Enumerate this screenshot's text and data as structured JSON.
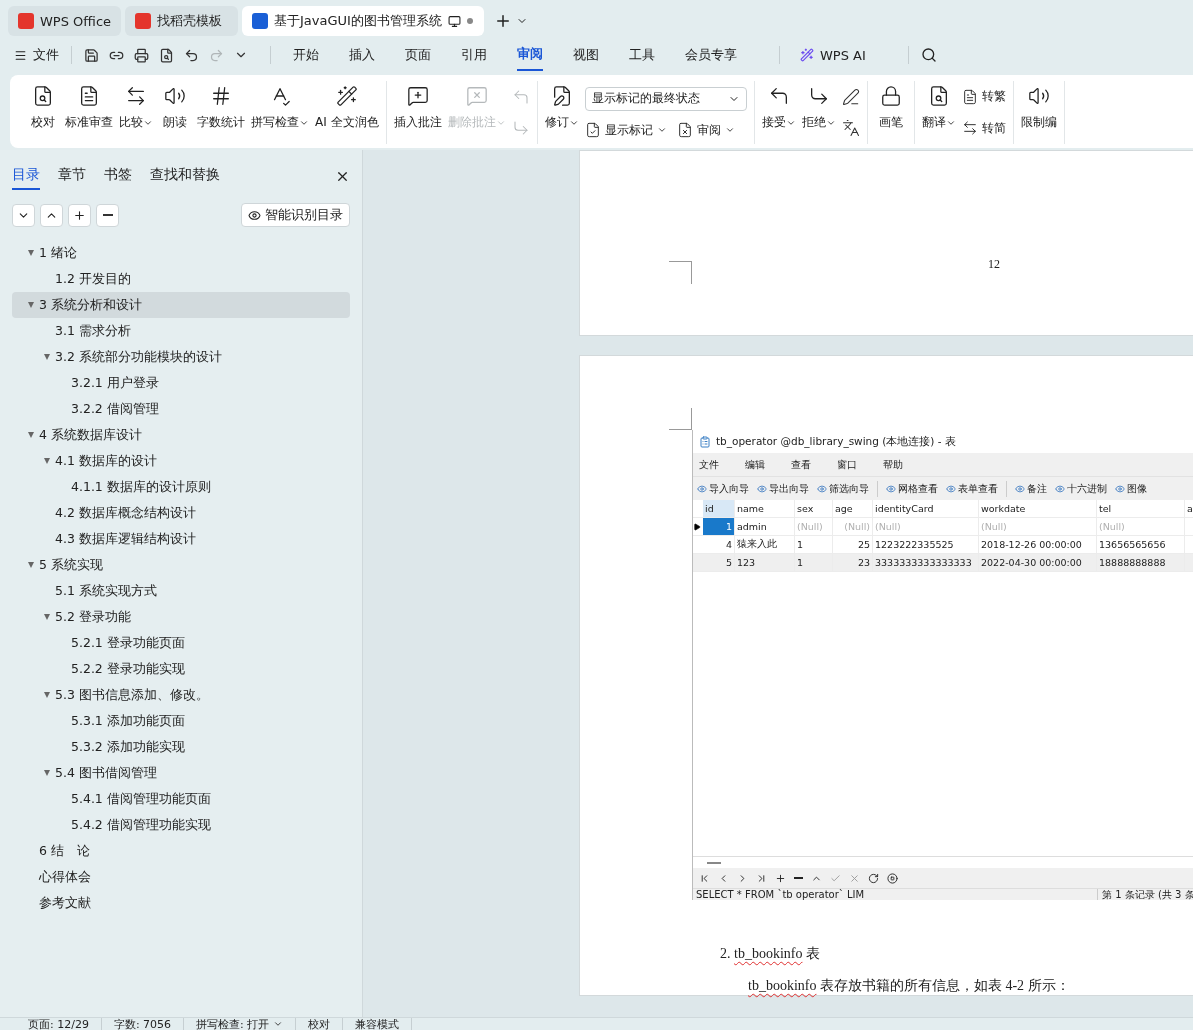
{
  "tabs": [
    {
      "label": "WPS Office",
      "selected": false
    },
    {
      "label": "找稻壳模板",
      "selected": false
    },
    {
      "label": "基于JavaGUI的图书管理系统",
      "selected": true
    }
  ],
  "menu": {
    "file": "文件",
    "items": [
      {
        "label": "开始",
        "selected": false
      },
      {
        "label": "插入",
        "selected": false
      },
      {
        "label": "页面",
        "selected": false
      },
      {
        "label": "引用",
        "selected": false
      },
      {
        "label": "审阅",
        "selected": true
      },
      {
        "label": "视图",
        "selected": false
      },
      {
        "label": "工具",
        "selected": false
      },
      {
        "label": "会员专享",
        "selected": false
      }
    ],
    "ai": "WPS AI"
  },
  "ribbon": [
    {
      "items": [
        {
          "kind": "big",
          "label": "校对",
          "dropdown": false,
          "disabled": false
        },
        {
          "kind": "big",
          "label": "标准审查",
          "dropdown": false,
          "disabled": false
        },
        {
          "kind": "big",
          "label": "比较",
          "dropdown": true,
          "disabled": false
        },
        {
          "kind": "big",
          "label": "朗读",
          "dropdown": false,
          "disabled": false
        },
        {
          "kind": "big",
          "label": "字数统计",
          "dropdown": false,
          "disabled": false
        },
        {
          "kind": "big",
          "label": "拼写检查",
          "dropdown": true,
          "disabled": false
        },
        {
          "kind": "big",
          "label": "AI 全文润色",
          "dropdown": false,
          "disabled": false
        }
      ]
    },
    {
      "items": [
        {
          "kind": "big",
          "label": "插入批注",
          "dropdown": false,
          "disabled": false
        },
        {
          "kind": "big",
          "label": "删除批注",
          "dropdown": true,
          "disabled": true
        },
        {
          "kind": "icons",
          "buttons": [
            {
              "disabled": true
            },
            {
              "disabled": true
            }
          ]
        }
      ]
    },
    {
      "items": [
        {
          "kind": "big",
          "label": "修订",
          "dropdown": true,
          "disabled": false
        },
        {
          "kind": "stack",
          "rows": [
            [
              {
                "kind": "select",
                "value": "显示标记的最终状态"
              }
            ],
            [
              {
                "kind": "small",
                "label": "显示标记",
                "dropdown": true
              },
              {
                "kind": "small",
                "label": "审阅",
                "dropdown": true
              }
            ]
          ]
        }
      ]
    },
    {
      "items": [
        {
          "kind": "big",
          "label": "接受",
          "dropdown": true,
          "disabled": false
        },
        {
          "kind": "big",
          "label": "拒绝",
          "dropdown": true,
          "disabled": false
        },
        {
          "kind": "icons",
          "buttons": [
            {
              "disabled": false
            },
            {
              "disabled": false
            }
          ]
        }
      ]
    },
    {
      "items": [
        {
          "kind": "big",
          "label": "画笔",
          "dropdown": false,
          "disabled": false
        }
      ]
    },
    {
      "items": [
        {
          "kind": "big",
          "label": "翻译",
          "dropdown": true,
          "disabled": false
        },
        {
          "kind": "stack",
          "rows": [
            [
              {
                "kind": "small",
                "label": "转繁",
                "dropdown": false
              }
            ],
            [
              {
                "kind": "small",
                "label": "转简",
                "dropdown": false
              }
            ]
          ]
        }
      ]
    },
    {
      "items": [
        {
          "kind": "big",
          "label": "限制编",
          "dropdown": false,
          "disabled": false
        }
      ]
    }
  ],
  "sidebar": {
    "tabs": [
      {
        "label": "目录",
        "selected": true
      },
      {
        "label": "章节",
        "selected": false
      },
      {
        "label": "书签",
        "selected": false
      },
      {
        "label": "查找和替换",
        "selected": false
      }
    ],
    "smart_button": "智能识别目录",
    "toc": [
      {
        "label": "1  绪论",
        "selected": false,
        "expanded": true,
        "children": [
          {
            "label": "1.2  开发目的",
            "selected": false
          }
        ]
      },
      {
        "label": "3  系统分析和设计",
        "selected": true,
        "expanded": true,
        "children": [
          {
            "label": "3.1  需求分析",
            "selected": false
          },
          {
            "label": "3.2  系统部分功能模块的设计",
            "selected": false,
            "expanded": true,
            "children": [
              {
                "label": "3.2.1  用户登录",
                "selected": false
              },
              {
                "label": "3.2.2  借阅管理",
                "selected": false
              }
            ]
          }
        ]
      },
      {
        "label": "4  系统数据库设计",
        "selected": false,
        "expanded": true,
        "children": [
          {
            "label": "4.1  数据库的设计",
            "selected": false,
            "expanded": true,
            "children": [
              {
                "label": "4.1.1  数据库的设计原则",
                "selected": false
              }
            ]
          },
          {
            "label": "4.2  数据库概念结构设计",
            "selected": false
          },
          {
            "label": "4.3  数据库逻辑结构设计",
            "selected": false
          }
        ]
      },
      {
        "label": "5  系统实现",
        "selected": false,
        "expanded": true,
        "children": [
          {
            "label": "5.1 系统实现方式",
            "selected": false
          },
          {
            "label": "5.2 登录功能",
            "selected": false,
            "expanded": true,
            "children": [
              {
                "label": "5.2.1 登录功能页面",
                "selected": false
              },
              {
                "label": "5.2.2 登录功能实现",
                "selected": false
              }
            ]
          },
          {
            "label": "5.3 图书信息添加、修改。",
            "selected": false,
            "expanded": true,
            "children": [
              {
                "label": "5.3.1 添加功能页面",
                "selected": false
              },
              {
                "label": "5.3.2 添加功能实现",
                "selected": false
              }
            ]
          },
          {
            "label": "5.4 图书借阅管理",
            "selected": false,
            "expanded": true,
            "children": [
              {
                "label": "5.4.1 借阅管理功能页面",
                "selected": false
              },
              {
                "label": "5.4.2 借阅管理功能实现",
                "selected": false
              }
            ]
          }
        ]
      },
      {
        "label": "6 结　论",
        "selected": false
      },
      {
        "label": "心得体会",
        "selected": false
      },
      {
        "label": "参考文献",
        "selected": false
      }
    ]
  },
  "document": {
    "page_number": "12",
    "embedded_window": {
      "title": "tb_operator @db_library_swing (本地连接) - 表",
      "menu": [
        "文件",
        "编辑",
        "查看",
        "窗口",
        "帮助"
      ],
      "toolbar": [
        [
          "导入向导",
          "导出向导",
          "筛选向导"
        ],
        [
          "网格查看",
          "表单查看"
        ],
        [
          "备注",
          "十六进制",
          "图像"
        ]
      ],
      "columns": [
        "id",
        "name",
        "sex",
        "age",
        "identityCard",
        "workdate",
        "tel",
        "a"
      ],
      "rows": [
        {
          "selected": true,
          "cells": [
            "1",
            "admin",
            "(Null)",
            "(Null)",
            "(Null)",
            "(Null)",
            "(Null)"
          ]
        },
        {
          "selected": false,
          "cells": [
            "4",
            "猿来入此",
            "1",
            "25",
            "1223222335525",
            "2018-12-26 00:00:00",
            "13656565656"
          ]
        },
        {
          "selected": false,
          "cells": [
            "5",
            "123",
            "1",
            "23",
            "3333333333333333",
            "2022-04-30 00:00:00",
            "18888888888"
          ]
        }
      ],
      "sql": "SELECT * FROM `tb operator` LIM",
      "record": "第 1 条记录 (共 3 条"
    },
    "paragraphs": [
      {
        "kind": "heading",
        "parts": [
          {
            "text": "2. "
          },
          {
            "text": "tb_bookinfo",
            "misspelled": true
          },
          {
            "text": " 表"
          }
        ]
      },
      {
        "kind": "body",
        "parts": [
          {
            "text": "tb_bookinfo",
            "misspelled": true
          },
          {
            "text": " 表存放书籍的所有信息，如表 4-2 所示："
          }
        ]
      }
    ]
  },
  "status_bar": [
    {
      "label": "页面: 12/29",
      "dropdown": false
    },
    {
      "label": "字数: 7056",
      "dropdown": false
    },
    {
      "label": "拼写检查: 打开",
      "dropdown": true
    },
    {
      "label": "校对",
      "dropdown": false
    },
    {
      "label": "兼容模式",
      "dropdown": false
    }
  ]
}
